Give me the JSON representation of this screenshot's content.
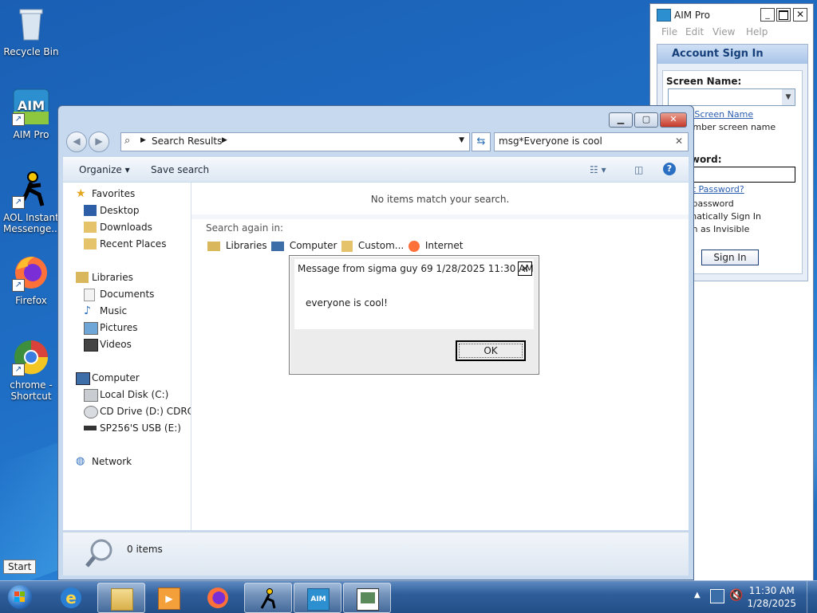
{
  "desktop": {
    "icons": [
      {
        "label": "Recycle Bin",
        "icon": "recycle-bin-icon"
      },
      {
        "label": "AIM Pro",
        "icon": "aim-pro-icon"
      },
      {
        "label": "AOL Instant Messenge...",
        "icon": "aol-instant-messenger-icon"
      },
      {
        "label": "Firefox",
        "icon": "firefox-icon"
      },
      {
        "label": "chrome - Shortcut",
        "icon": "chrome-icon"
      }
    ]
  },
  "explorer": {
    "address_label": "Search Results",
    "search_value": "msg*Everyone is cool",
    "toolbar": {
      "organize": "Organize",
      "save_search": "Save search"
    },
    "nav": {
      "favorites": "Favorites",
      "favorites_items": [
        "Desktop",
        "Downloads",
        "Recent Places"
      ],
      "libraries": "Libraries",
      "libraries_items": [
        "Documents",
        "Music",
        "Pictures",
        "Videos"
      ],
      "computer": "Computer",
      "computer_items": [
        "Local Disk (C:)",
        "CD Drive (D:) CDROM",
        "SP256'S USB (E:)"
      ],
      "network": "Network"
    },
    "content": {
      "no_items": "No items match your search.",
      "search_again": "Search again in:",
      "locations": [
        "Libraries",
        "Computer",
        "Custom...",
        "Internet"
      ]
    },
    "status": "0 items"
  },
  "aim": {
    "title": "AIM Pro",
    "menu": [
      "File",
      "Edit",
      "View",
      "Help"
    ],
    "panel_title": "Account Sign In",
    "screen_name_label": "Screen Name:",
    "get_screen_name": "Get a Screen Name",
    "remember_screen_name": "Remember screen name",
    "password_label": "Password:",
    "forgot_password": "Forgot Password?",
    "save_password": "Save password",
    "auto_sign_in": "Automatically Sign In",
    "sign_in_invisible": "Sign in as Invisible",
    "sign_in_button": "Sign In"
  },
  "dialog": {
    "title": "Message from sigma guy 69 1/28/2025 11:30 AM",
    "message": "everyone is cool!",
    "ok": "OK"
  },
  "taskbar": {
    "start_tooltip": "Start",
    "time": "11:30 AM",
    "date": "1/28/2025"
  }
}
